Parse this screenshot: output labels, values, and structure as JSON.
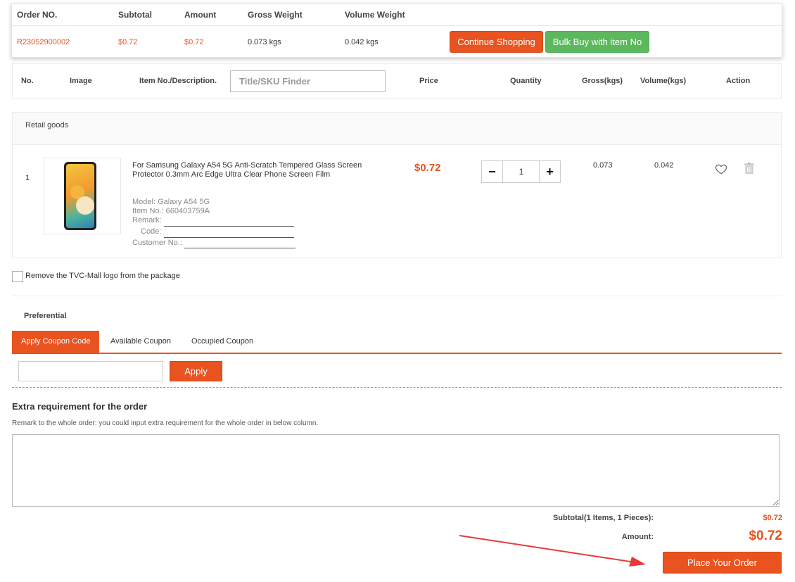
{
  "order_summary": {
    "headers": {
      "order_no": "Order NO.",
      "subtotal": "Subtotal",
      "amount": "Amount",
      "gross_weight": "Gross Weight",
      "volume_weight": "Volume Weight"
    },
    "values": {
      "order_no": "R23052900002",
      "subtotal": "$0.72",
      "amount": "$0.72",
      "gross_weight": "0.073 kgs",
      "volume_weight": "0.042 kgs"
    },
    "continue_label": "Continue Shopping",
    "bulk_label": "Bulk Buy with item No"
  },
  "table_header": {
    "no": "No.",
    "image": "Image",
    "item": "Item No./Description.",
    "sku_placeholder": "Title/SKU Finder",
    "price": "Price",
    "quantity": "Quantity",
    "gross": "Gross(kgs)",
    "volume": "Volume(kgs)",
    "action": "Action"
  },
  "retail": {
    "section_title": "Retail goods",
    "item": {
      "index": "1",
      "description": "For Samsung Galaxy A54 5G Anti-Scratch Tempered Glass Screen Protector 0.3mm Arc Edge Ultra Clear Phone Screen Film",
      "model": "Model: Galaxy A54 5G",
      "item_no": "Item No.: 660403759A",
      "remark_label": "Remark:",
      "code_label": "Code:",
      "customer_no_label": "Customer No.:",
      "price": "$0.72",
      "quantity": "1",
      "gross": "0.073",
      "volume": "0.042"
    }
  },
  "remove_logo_label": "Remove the TVC-Mall logo from the package",
  "preferential": {
    "title": "Preferential",
    "tabs": [
      "Apply Coupon Code",
      "Available Coupon",
      "Occupied Coupon"
    ],
    "apply_label": "Apply"
  },
  "extra": {
    "title": "Extra requirement for the order",
    "description": "Remark to the whole order: you could input extra requirement for the whole order in below column."
  },
  "totals": {
    "subtotal_label": "Subtotal(1 Items, 1 Pieces):",
    "subtotal_value": "$0.72",
    "amount_label": "Amount:",
    "amount_value": "$0.72",
    "place_order_label": "Place Your Order"
  },
  "colors": {
    "accent": "#e9531f",
    "green": "#5cb85c",
    "annotation_arrow": "#e8393a"
  }
}
